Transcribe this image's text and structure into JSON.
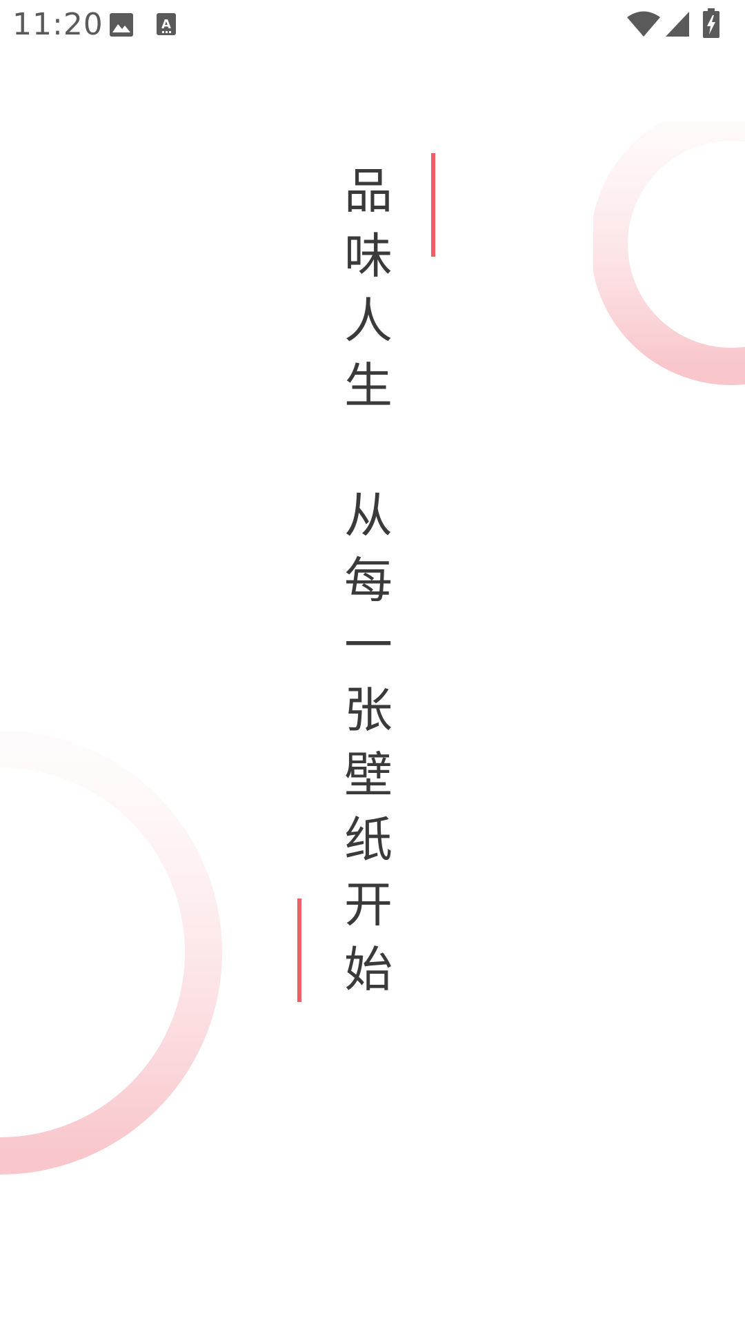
{
  "status_bar": {
    "time": "11:20",
    "icons": [
      "gallery-icon",
      "text-notification-icon",
      "wifi-icon",
      "signal-icon",
      "battery-charging-icon"
    ]
  },
  "colors": {
    "accent": "#ef5f66",
    "text": "#3a3a3a",
    "ring": "#f8c6cb",
    "status": "#5a5a5a",
    "background": "#ffffff"
  },
  "slogan": {
    "line1": [
      "品",
      "味",
      "人",
      "生"
    ],
    "line2": [
      "从",
      "每",
      "一",
      "张",
      "壁",
      "纸",
      "开",
      "始"
    ]
  }
}
